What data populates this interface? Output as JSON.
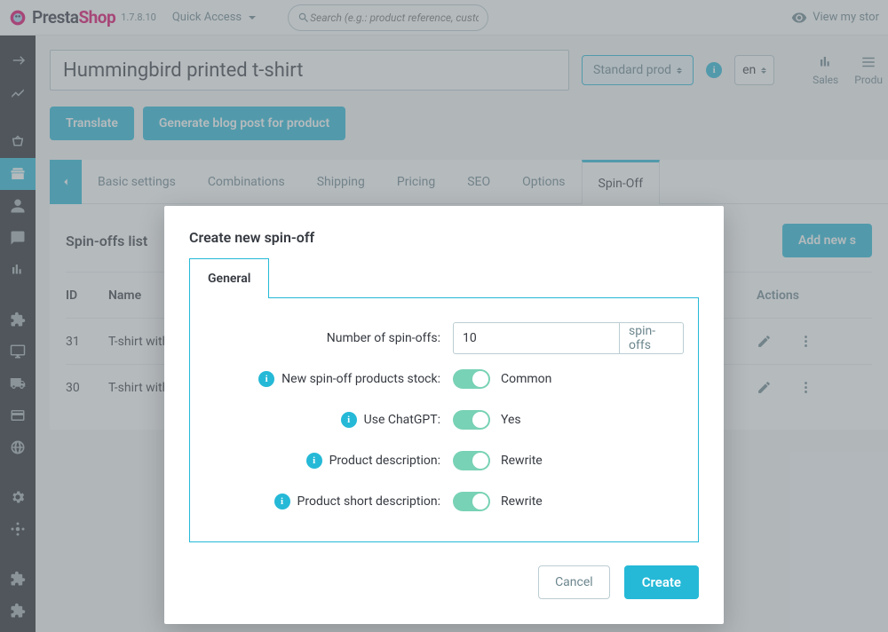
{
  "header": {
    "brand_a": "Presta",
    "brand_b": "Shop",
    "version": "1.7.8.10",
    "quick_access": "Quick Access",
    "search_placeholder": "Search (e.g.: product reference, custom",
    "view_store": "View my stor"
  },
  "product": {
    "name": "Hummingbird printed t-shirt",
    "type": "Standard prod",
    "lang": "en",
    "stats": {
      "sales": "Sales",
      "product": "Produ"
    }
  },
  "buttons": {
    "translate": "Translate",
    "gen_blog": "Generate blog post for product",
    "add_new": "Add new s"
  },
  "tabs": [
    "Basic settings",
    "Combinations",
    "Shipping",
    "Pricing",
    "SEO",
    "Options",
    "Spin-Off"
  ],
  "list": {
    "title": "Spin-offs list",
    "col_id": "ID",
    "col_name": "Name",
    "col_actions": "Actions",
    "rows": [
      {
        "id": "31",
        "name": "T-shirt with a print o"
      },
      {
        "id": "30",
        "name": "T-shirt with a print o"
      }
    ]
  },
  "modal": {
    "title": "Create new spin-off",
    "tab": "General",
    "fields": {
      "num_label": "Number of spin-offs:",
      "num_value": "10",
      "num_suffix": "spin-offs",
      "stock_label": "New spin-off products stock:",
      "stock_value": "Common",
      "gpt_label": "Use ChatGPT:",
      "gpt_value": "Yes",
      "desc_label": "Product description:",
      "desc_value": "Rewrite",
      "short_label": "Product short description:",
      "short_value": "Rewrite"
    },
    "cancel": "Cancel",
    "create": "Create"
  }
}
